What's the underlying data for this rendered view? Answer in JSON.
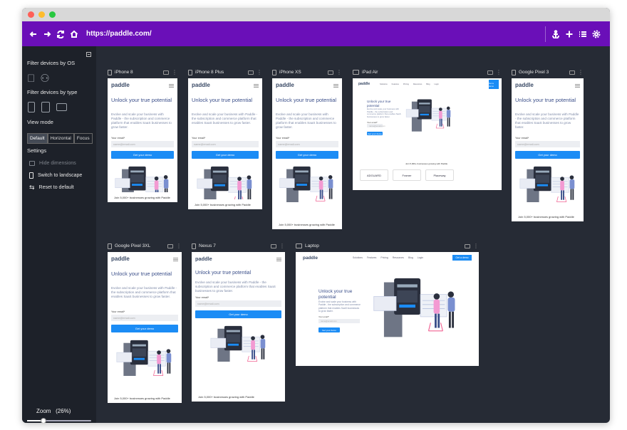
{
  "toolbar": {
    "url": "https://paddle.com/"
  },
  "sidebar": {
    "filter_os_label": "Filter devices by OS",
    "filter_type_label": "Filter devices by type",
    "view_mode_label": "View mode",
    "view_modes": [
      "Default",
      "Horizontal",
      "Focus"
    ],
    "active_view_mode": "Default",
    "settings_label": "Settings",
    "settings_items": [
      "Hide dimensions",
      "Switch to landscape",
      "Reset to default"
    ],
    "zoom_label": "Zoom",
    "zoom_value": "(26%)",
    "zoom_level": 0.26
  },
  "page": {
    "logo": "paddle",
    "headline": "Unlock your true potential",
    "subtext": "Evolve and scale your business with Paddle - the subscription and commerce platform that enables SaaS businesses to grow faster.",
    "email_label": "Your email*",
    "email_placeholder": "name@email.com",
    "cta_label": "Get your demo",
    "footer_text": "Join 5,000+ businesses growing with Paddle",
    "nav_items": [
      "Solutions",
      "Features",
      "Pricing",
      "Resources",
      "Blog",
      "Login"
    ],
    "nav_cta": "Get a demo",
    "partners": [
      "ADGUARD",
      "Framer",
      "Placeway"
    ]
  },
  "devices": [
    {
      "name": "iPhone 8"
    },
    {
      "name": "iPhone 8 Plus"
    },
    {
      "name": "iPhone XS"
    },
    {
      "name": "iPad Air"
    },
    {
      "name": "Google Pixel 3"
    },
    {
      "name": "Google Pixel 3XL"
    },
    {
      "name": "Nexus 7"
    },
    {
      "name": "Laptop"
    }
  ],
  "colors": {
    "toolbar": "#6a0fb8",
    "canvas": "#262b35",
    "sidebar": "#1d2129",
    "cta": "#1b8cf5"
  }
}
